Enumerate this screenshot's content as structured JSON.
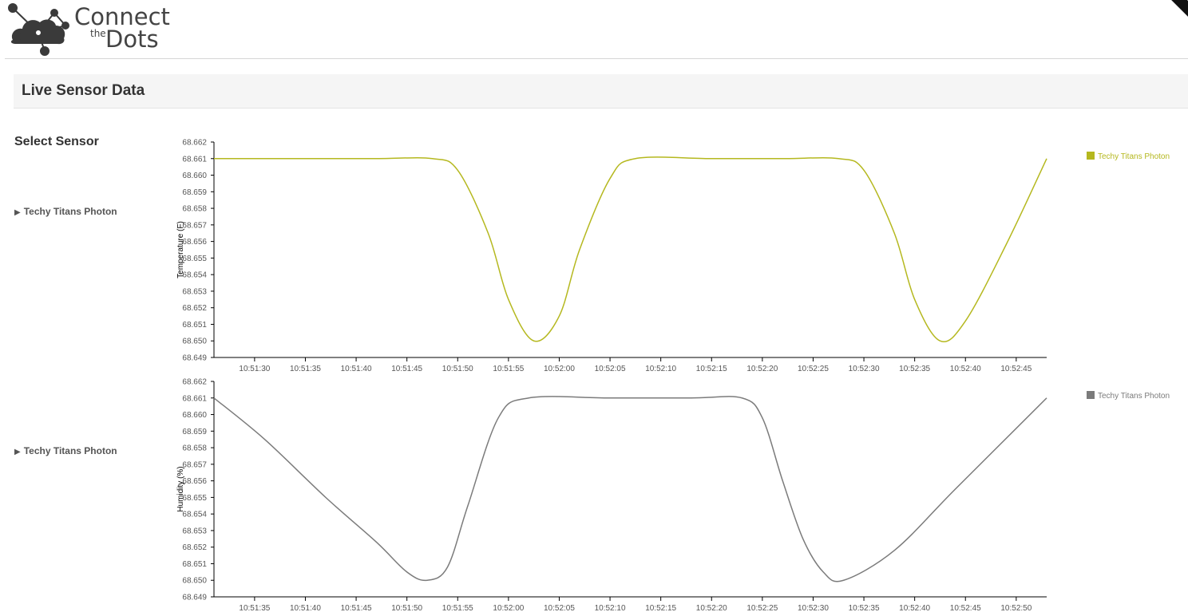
{
  "header": {
    "logo_connect": "Connect",
    "logo_the": "the",
    "logo_dots": "Dots"
  },
  "section": {
    "title": "Live Sensor Data"
  },
  "sidebar": {
    "select_label": "Select Sensor",
    "sensors": [
      {
        "label": "Techy Titans Photon"
      },
      {
        "label": "Techy Titans Photon"
      }
    ]
  },
  "colors": {
    "temperature_series": "#b5b81f",
    "humidity_series": "#7b7b7b"
  },
  "chart_data": [
    {
      "type": "line",
      "ylabel": "Temperature (F)",
      "xlabel": "",
      "ylim": [
        68.649,
        68.662
      ],
      "yticks": [
        "68.662",
        "68.661",
        "68.660",
        "68.659",
        "68.658",
        "68.657",
        "68.656",
        "68.655",
        "68.654",
        "68.653",
        "68.652",
        "68.651",
        "68.650",
        "68.649"
      ],
      "xticks": [
        "10:51:30",
        "10:51:35",
        "10:51:40",
        "10:51:45",
        "10:51:50",
        "10:51:55",
        "10:52:00",
        "10:52:05",
        "10:52:10",
        "10:52:15",
        "10:52:20",
        "10:52:25",
        "10:52:30",
        "10:52:35",
        "10:52:40",
        "10:52:45"
      ],
      "xlim": [
        "10:51:26",
        "10:52:48"
      ],
      "legend": [
        "Techy Titans Photon"
      ],
      "legend_position": "top-right",
      "series": [
        {
          "name": "Techy Titans Photon",
          "x": [
            "10:51:26",
            "10:51:34",
            "10:51:42",
            "10:51:47.5",
            "10:51:50",
            "10:51:53",
            "10:51:55",
            "10:51:57.5",
            "10:52:00",
            "10:52:02",
            "10:52:05",
            "10:52:07.5",
            "10:52:15",
            "10:52:22",
            "10:52:27.5",
            "10:52:30",
            "10:52:33",
            "10:52:35",
            "10:52:37.5",
            "10:52:40",
            "10:52:44",
            "10:52:48"
          ],
          "y": [
            68.661,
            68.661,
            68.661,
            68.661,
            68.6603,
            68.6565,
            68.6525,
            68.65,
            68.6515,
            68.6555,
            68.6598,
            68.661,
            68.661,
            68.661,
            68.661,
            68.6603,
            68.6565,
            68.6525,
            68.65,
            68.6512,
            68.6558,
            68.661
          ]
        }
      ]
    },
    {
      "type": "line",
      "ylabel": "Humidity (%)",
      "xlabel": "",
      "ylim": [
        68.649,
        68.662
      ],
      "yticks": [
        "68.662",
        "68.661",
        "68.660",
        "68.659",
        "68.658",
        "68.657",
        "68.656",
        "68.655",
        "68.654",
        "68.653",
        "68.652",
        "68.651",
        "68.650",
        "68.649"
      ],
      "xticks": [
        "10:51:35",
        "10:51:40",
        "10:51:45",
        "10:51:50",
        "10:51:55",
        "10:52:00",
        "10:52:05",
        "10:52:10",
        "10:52:15",
        "10:52:20",
        "10:52:25",
        "10:52:30",
        "10:52:35",
        "10:52:40",
        "10:52:45",
        "10:52:50"
      ],
      "xlim": [
        "10:51:31",
        "10:52:53"
      ],
      "legend": [
        "Techy Titans Photon"
      ],
      "legend_position": "top-right",
      "series": [
        {
          "name": "Techy Titans Photon",
          "x": [
            "10:51:31",
            "10:51:36",
            "10:51:42",
            "10:51:47",
            "10:51:50",
            "10:51:52",
            "10:51:54",
            "10:51:56",
            "10:51:59",
            "10:52:02",
            "10:52:10",
            "10:52:18",
            "10:52:23",
            "10:52:25",
            "10:52:27",
            "10:52:29",
            "10:52:31",
            "10:52:33",
            "10:52:38",
            "10:52:44",
            "10:52:53"
          ],
          "y": [
            68.661,
            68.6585,
            68.655,
            68.6523,
            68.6505,
            68.65,
            68.6508,
            68.6545,
            68.6598,
            68.661,
            68.661,
            68.661,
            68.661,
            68.6598,
            68.656,
            68.6525,
            68.6505,
            68.65,
            68.6518,
            68.6555,
            68.661
          ]
        }
      ]
    }
  ]
}
